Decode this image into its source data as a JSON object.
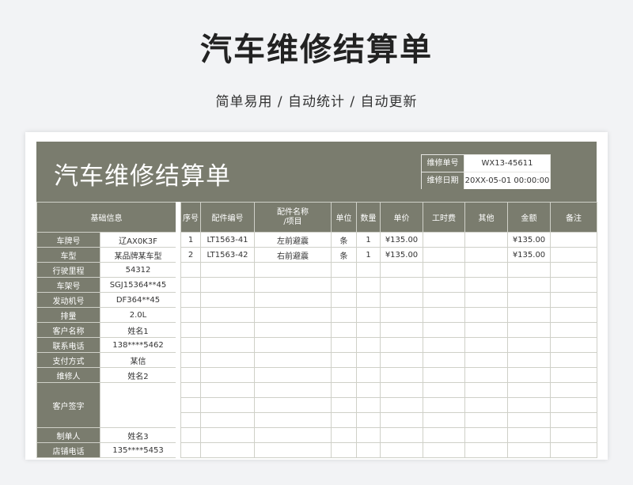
{
  "page": {
    "title": "汽车维修结算单",
    "subtitle": "简单易用 / 自动统计 / 自动更新"
  },
  "banner": {
    "title": "汽车维修结算单",
    "order_no_label": "维修单号",
    "order_no": "WX13-45611",
    "date_label": "维修日期",
    "date": "20XX-05-01 00:00:00"
  },
  "basic_info": {
    "header": "基础信息",
    "rows": [
      {
        "label": "车牌号",
        "value": "辽AX0K3F"
      },
      {
        "label": "车型",
        "value": "某品牌某车型"
      },
      {
        "label": "行驶里程",
        "value": "54312"
      },
      {
        "label": "车架号",
        "value": "SGJ15364**45"
      },
      {
        "label": "发动机号",
        "value": "DF364**45"
      },
      {
        "label": "排量",
        "value": "2.0L"
      },
      {
        "label": "客户名称",
        "value": "姓名1"
      },
      {
        "label": "联系电话",
        "value": "138****5462"
      },
      {
        "label": "支付方式",
        "value": "某信"
      },
      {
        "label": "维修人",
        "value": "姓名2"
      }
    ],
    "signature_label": "客户签字",
    "signature_value": "",
    "maker_label": "制单人",
    "maker_value": "姓名3",
    "contact_label": "店铺电话",
    "contact_value": "135****5453"
  },
  "parts": {
    "headers": [
      "序号",
      "配件编号",
      "配件名称\n/项目",
      "单位",
      "数量",
      "单价",
      "工时费",
      "其他",
      "金额",
      "备注"
    ],
    "rows": [
      [
        "1",
        "LT1563-41",
        "左前避震",
        "条",
        "1",
        "¥135.00",
        "",
        "",
        "¥135.00",
        ""
      ],
      [
        "2",
        "LT1563-42",
        "右前避震",
        "条",
        "1",
        "¥135.00",
        "",
        "",
        "¥135.00",
        ""
      ]
    ]
  }
}
